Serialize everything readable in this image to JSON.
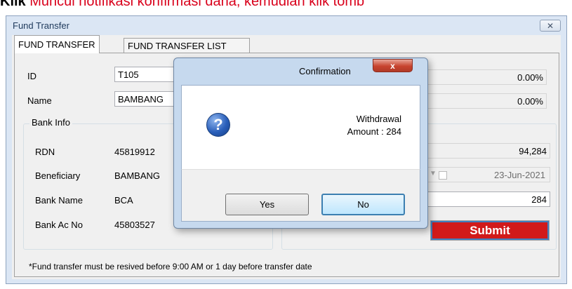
{
  "caption": {
    "prefix": "Klik",
    "text": " Muncul notifikasi konfirmasi dana, kemudian klik tomb"
  },
  "window": {
    "title": "Fund Transfer",
    "close_label": "✕"
  },
  "tabs": [
    {
      "label": "FUND TRANSFER"
    },
    {
      "label": "FUND TRANSFER LIST"
    }
  ],
  "form": {
    "id_label": "ID",
    "id_value": "T105",
    "name_label": "Name",
    "name_value": "BAMBANG",
    "rate1_value": "0.00%",
    "rate2_value": "0.00%"
  },
  "bank_info": {
    "title": "Bank Info",
    "rdn_label": "RDN",
    "rdn_value": "45819912",
    "beneficiary_label": "Beneficiary",
    "beneficiary_value": "BAMBANG",
    "bank_name_label": "Bank Name",
    "bank_name_value": "BCA",
    "bank_ac_label": "Bank Ac No",
    "bank_ac_value": "45803527"
  },
  "transfer": {
    "balance_value": "94,284",
    "date_value": "23-Jun-2021",
    "amount_value": "284",
    "submit_label": "Submit"
  },
  "footnote": "*Fund transfer must be resived before 9:00 AM or 1 day before transfer date",
  "dialog": {
    "title": "Confirmation",
    "close_label": "x",
    "message_line1": "Withdrawal",
    "message_line2": "Amount : 284",
    "icon": "question-icon",
    "yes_label": "Yes",
    "no_label": "No"
  },
  "colors": {
    "submit_bg": "#d11a1a",
    "caption": "#d9001b",
    "window_frame": "#dbe6f4"
  }
}
